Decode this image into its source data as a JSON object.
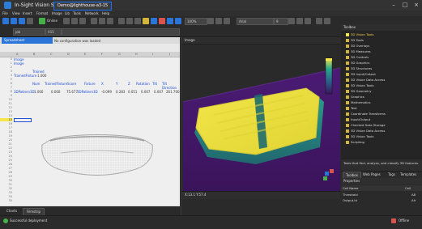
{
  "app": {
    "title": "In-Sight Vision Suite",
    "document_tab": "Demo@lighthouse-a3-15"
  },
  "menu": [
    "File",
    "View",
    "Insert",
    "Format",
    "Image",
    "Lib",
    "Tools",
    "Network",
    "Help"
  ],
  "toolbar": {
    "online_label": "Online",
    "zoom_value": "100%",
    "font_value": "Arial",
    "size_value": "9"
  },
  "toolbar2": {
    "job_value": "job",
    "cell_ref": "A15"
  },
  "left_panel": {
    "tab_title": "Spreadsheet",
    "tab_hint": "No configuration was loaded",
    "rows": {
      "r1": "Image",
      "r2": "Image",
      "r3_label": "Trained",
      "r4_label": "TrainedFixture",
      "r4_value": "1.000",
      "r6_label": "Num",
      "r6_c2": "TrainedFixture",
      "r6_c3": "Score",
      "r6_c4": "Fixture",
      "r6_c5": "X",
      "r6_c6": "Y",
      "r6_c7": "Z",
      "r6_c8": "Rotation",
      "r6_c9": "Tilt",
      "r6_c10": "Tilt Direction",
      "r8_label": "3DPattern3D",
      "r8_num": "1.000",
      "r8_fixture_val": "0.000",
      "r8_score": "75.677",
      "r8_fixture": "3DPattern3D",
      "r8_x": "-0.099",
      "r8_y": "0.283",
      "r8_z": "0.051",
      "r8_rot": "0.007",
      "r8_tilt": "0.007",
      "r8_tiltdir": "261.700"
    }
  },
  "bottom_tabs": [
    "Charts",
    "Filmstrip"
  ],
  "status": {
    "deploy": "Successful deployment",
    "online": "Offline"
  },
  "center_panel": {
    "title": "Image",
    "bottom_text": "X:13.1 Y:57.4"
  },
  "toolbox": {
    "title": "Toolbox",
    "items": [
      "3D Vision Tools",
      "3D Tools",
      "3D Overlays",
      "3D Measures",
      "3D Controls",
      "3D Graphics",
      "3D Structures",
      "3D Input/Output",
      "3D Vision Data Access",
      "3D Vision Tools",
      "3D Geometry",
      "Graphics",
      "Mathematics",
      "Text",
      "Coordinate Transforms",
      "Input/Output",
      "Checked Data Storage",
      "3D Vision Data Access",
      "3D Vision Tools",
      "Scripting"
    ],
    "highlight_index": 0,
    "description": "Tools that find, analyze, and classify 3D features."
  },
  "toolbox_tabs": [
    "Toolbox",
    "Web Pages",
    "Tags",
    "Templates"
  ],
  "properties": {
    "title": "Properties",
    "header_name": "Cell Name",
    "header_cell": "Cell",
    "rows": [
      {
        "name": "Threshold",
        "cell": "A8"
      },
      {
        "name": "Output.id",
        "cell": "A9"
      }
    ]
  },
  "colors": {
    "accent": "#2b75d8",
    "heatmap_yellow": "#f3e54a",
    "heatmap_teal": "#2aa78a",
    "heatmap_purple": "#4b1b74"
  }
}
